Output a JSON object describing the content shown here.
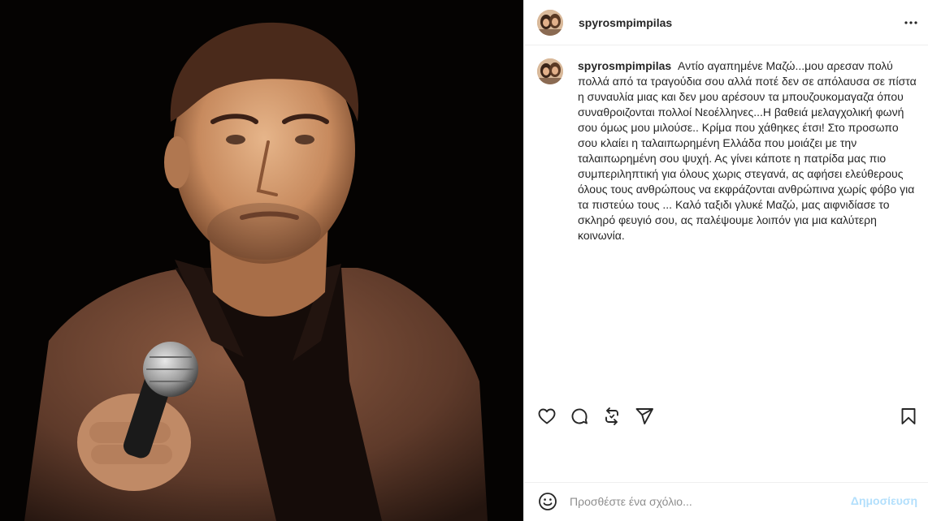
{
  "post": {
    "username": "spyrosmpimpilas",
    "photo_alt": "Photograph of a singer performing on stage holding a microphone"
  },
  "caption": {
    "username": "spyrosmpimpilas",
    "text": "Αντίο αγαπημένε Μαζώ...μου αρεσαν πολύ πολλά από τα τραγούδια σου αλλά ποτέ δεν σε απόλαυσα σε πίστα η συναυλία μιας και δεν μου αρέσουν τα μπουζουκομαγαζα όπου συναθροιζονται πολλοί Νεοέλληνες...Η βαθειά μελαγχολική φωνή σου όμως μου μιλούσε.. Κρίμα που χάθηκες έτσι! Στο προσωπο σου κλαίει η ταλαιπωρημένη Ελλάδα που μοιάζει με την ταλαιπωρημένη σου ψυχή. Ας γίνει κάποτε η πατρίδα μας πιο συμπεριληπτική για όλους χωρις στεγανά, ας αφήσει ελεύθερους όλους τους ανθρώπους να εκφράζονται ανθρώπινα χωρίς φόβο για τα πιστεύω τους ... Καλό ταξιδι γλυκέ Μαζώ, μας αιφνιδίασε το σκληρό φευγιό σου, ας παλέψουμε λοιπόν για μια καλύτερη κοινωνία."
  },
  "icons": {
    "more": "more-options-icon",
    "like": "heart-icon",
    "comment": "comment-bubble-icon",
    "repost": "repost-icon",
    "share": "send-paper-plane-icon",
    "save": "bookmark-icon",
    "emoji": "emoji-smiley-icon"
  },
  "comment_box": {
    "placeholder": "Προσθέστε ένα σχόλιο...",
    "post_label": "Δημοσίευση"
  },
  "colors": {
    "post_button_disabled": "#b2dffc",
    "border": "#efefef",
    "text": "#262626",
    "placeholder": "#8e8e8e"
  }
}
